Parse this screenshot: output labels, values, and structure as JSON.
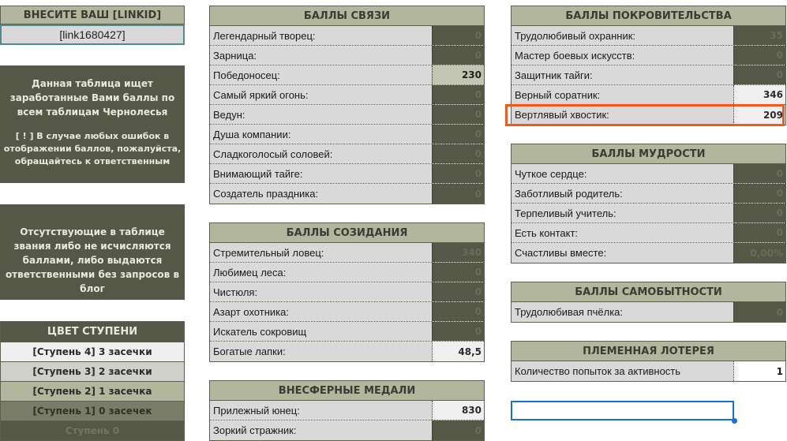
{
  "linkid": {
    "header": "ВНЕСИТЕ ВАШ [LINKID]",
    "value": "[link1680427]"
  },
  "info": {
    "line1": "Данная таблица ищет заработанные Вами баллы по всем таблицам Чернолесья",
    "line2": "[ ! ] В случае любых ошибок в отображении баллов, пожалуйста, обращайтесь к ответственным"
  },
  "notice": "Отсутствующие в таблице звания либо не исчисляются баллами, либо выдаются ответственными без запросов в блог",
  "steps": {
    "header": "ЦВЕТ СТУПЕНИ",
    "items": [
      {
        "label": "[Ступень 4] 3 засечки",
        "bg": "#efefef",
        "fg": "#2b2b2b"
      },
      {
        "label": "[Ступень 3] 2 засечки",
        "bg": "#d0d0ca",
        "fg": "#2b2b2b"
      },
      {
        "label": "[Ступень 2] 1 засечка",
        "bg": "#b1b69d",
        "fg": "#2b2b2b"
      },
      {
        "label": "[Ступень 1] 0 засечек",
        "bg": "#797d67",
        "fg": "#2f3129"
      },
      {
        "label": "Ступень 0",
        "bg": "#555846",
        "fg": "#73765f"
      }
    ]
  },
  "svyazi": {
    "header": "БАЛЛЫ СВЯЗИ",
    "rows": [
      {
        "label": "Легендарный творец:",
        "value": "0",
        "tone": "dark"
      },
      {
        "label": "Зарница:",
        "value": "0",
        "tone": "dark"
      },
      {
        "label": "Победоносец:",
        "value": "230",
        "tone": "mid"
      },
      {
        "label": "Самый яркий огонь:",
        "value": "0",
        "tone": "dark"
      },
      {
        "label": "Ведун:",
        "value": "0",
        "tone": "dark"
      },
      {
        "label": "Душа компании:",
        "value": "0",
        "tone": "dark"
      },
      {
        "label": "Сладкоголосый соловей:",
        "value": "0",
        "tone": "dark"
      },
      {
        "label": "Внимающий тайге:",
        "value": "0",
        "tone": "dark"
      },
      {
        "label": "Создатель праздника:",
        "value": "0",
        "tone": "dark"
      }
    ]
  },
  "sozidaniya": {
    "header": "БАЛЛЫ СОЗИДАНИЯ",
    "rows": [
      {
        "label": "Стремительный ловец:",
        "value": "340",
        "tone": "dark"
      },
      {
        "label": "Любимец леса:",
        "value": "0",
        "tone": "dark"
      },
      {
        "label": "Чистюля:",
        "value": "0",
        "tone": "dark"
      },
      {
        "label": "Азарт охотника:",
        "value": "0",
        "tone": "dark"
      },
      {
        "label": "Искатель сокровищ",
        "value": "0",
        "tone": "dark"
      },
      {
        "label": "Богатые лапки:",
        "value": "48,5",
        "tone": "light"
      }
    ]
  },
  "medali": {
    "header": "ВНЕСФЕРНЫЕ МЕДАЛИ",
    "rows": [
      {
        "label": "Прилежный юнец:",
        "value": "830",
        "tone": "light"
      },
      {
        "label": "Зоркий стражник:",
        "value": "0",
        "tone": "dark"
      }
    ]
  },
  "pokrov": {
    "header": "БАЛЛЫ ПОКРОВИТЕЛЬСТВА",
    "rows": [
      {
        "label": "Трудолюбивый охранник:",
        "value": "35",
        "tone": "dark"
      },
      {
        "label": "Мастер боевых искусств:",
        "value": "0",
        "tone": "dark"
      },
      {
        "label": "Защитник тайги:",
        "value": "0",
        "tone": "dark"
      },
      {
        "label": "Верный соратник:",
        "value": "346",
        "tone": "light"
      },
      {
        "label": "Вертлявый хвостик:",
        "value": "209",
        "tone": "light"
      }
    ]
  },
  "mudrosti": {
    "header": "БАЛЛЫ МУДРОСТИ",
    "rows": [
      {
        "label": "Чуткое сердце:",
        "value": "0",
        "tone": "dark"
      },
      {
        "label": "Заботливый родитель:",
        "value": "0",
        "tone": "dark"
      },
      {
        "label": "Терпеливый учитель:",
        "value": "0",
        "tone": "dark"
      },
      {
        "label": "Есть контакт:",
        "value": "0",
        "tone": "dark"
      },
      {
        "label": "Счастливы вместе:",
        "value": "0,00%",
        "tone": "dark"
      }
    ]
  },
  "samobyt": {
    "header": "БАЛЛЫ САМОБЫТНОСТИ",
    "rows": [
      {
        "label": "Трудолюбивая пчёлка:",
        "value": "0",
        "tone": "dark"
      }
    ]
  },
  "loterea": {
    "header": "ПЛЕМЕННАЯ ЛОТЕРЕЯ",
    "rows": [
      {
        "label": "Количество попыток за активность",
        "value": "1",
        "tone": "white"
      }
    ]
  },
  "colors": {
    "highlight": "#f25a1d",
    "selection": "#1a6fd1"
  }
}
